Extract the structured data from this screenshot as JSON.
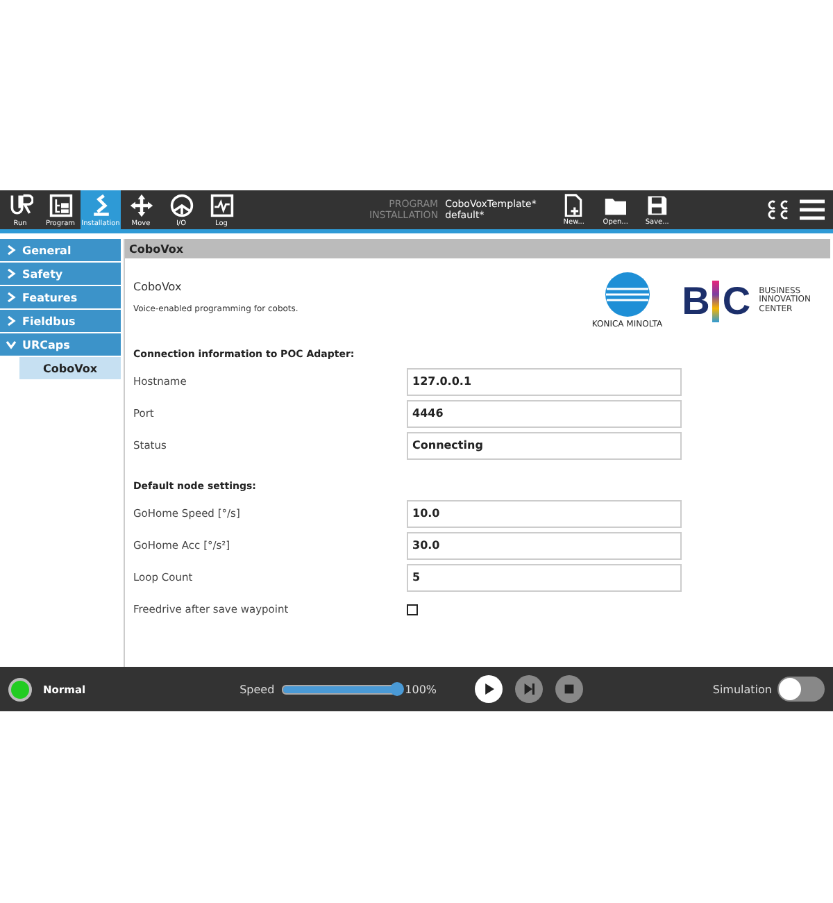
{
  "toolbar": {
    "tabs": [
      {
        "label": "Run",
        "kind": "ur",
        "selected": false
      },
      {
        "label": "Program",
        "kind": "program",
        "selected": false
      },
      {
        "label": "Installation",
        "kind": "installation",
        "selected": true
      },
      {
        "label": "Move",
        "kind": "move",
        "selected": false
      },
      {
        "label": "I/O",
        "kind": "io",
        "selected": false
      },
      {
        "label": "Log",
        "kind": "log",
        "selected": false
      }
    ],
    "file_info": [
      {
        "label": "PROGRAM",
        "value": "CoboVoxTemplate*"
      },
      {
        "label": "INSTALLATION",
        "value": "default*"
      }
    ],
    "file_buttons": [
      {
        "label": "New...",
        "kind": "new"
      },
      {
        "label": "Open...",
        "kind": "open"
      },
      {
        "label": "Save...",
        "kind": "save"
      }
    ]
  },
  "sidebar": {
    "items": [
      {
        "label": "General",
        "expanded": false
      },
      {
        "label": "Safety",
        "expanded": false
      },
      {
        "label": "Features",
        "expanded": false
      },
      {
        "label": "Fieldbus",
        "expanded": false
      },
      {
        "label": "URCaps",
        "expanded": true,
        "children": [
          {
            "label": "CoboVox",
            "selected": true
          }
        ]
      }
    ]
  },
  "panel": {
    "title": "CoboVox",
    "name": "CoboVox",
    "description": "Voice-enabled programming for cobots.",
    "logos": {
      "konica": "KONICA MINOLTA",
      "bic_letters": [
        "B",
        "C"
      ],
      "bic_text": [
        "BUSINESS",
        "INNOVATION",
        "CENTER"
      ]
    },
    "sections": [
      {
        "heading": "Connection information to POC Adapter:",
        "rows": [
          {
            "label": "Hostname",
            "kind": "field",
            "value": "127.0.0.1"
          },
          {
            "label": "Port",
            "kind": "field",
            "value": "4446"
          },
          {
            "label": "Status",
            "kind": "field",
            "value": "Connecting"
          }
        ]
      },
      {
        "heading": "Default node settings:",
        "rows": [
          {
            "label": "GoHome Speed [°/s]",
            "kind": "field",
            "value": "10.0"
          },
          {
            "label": "GoHome Acc [°/s²]",
            "kind": "field",
            "value": "30.0"
          },
          {
            "label": "Loop Count",
            "kind": "field",
            "value": "5"
          },
          {
            "label": "Freedrive after save waypoint",
            "kind": "checkbox",
            "checked": false
          }
        ]
      }
    ]
  },
  "footer": {
    "status": {
      "label": "Normal",
      "color": "#22cc22"
    },
    "speed": {
      "label": "Speed",
      "level": 1.0,
      "reading": "100%"
    },
    "controls": [
      {
        "kind": "play"
      },
      {
        "kind": "step"
      },
      {
        "kind": "stop"
      }
    ],
    "simulation": {
      "label": "Simulation",
      "on": false
    }
  }
}
